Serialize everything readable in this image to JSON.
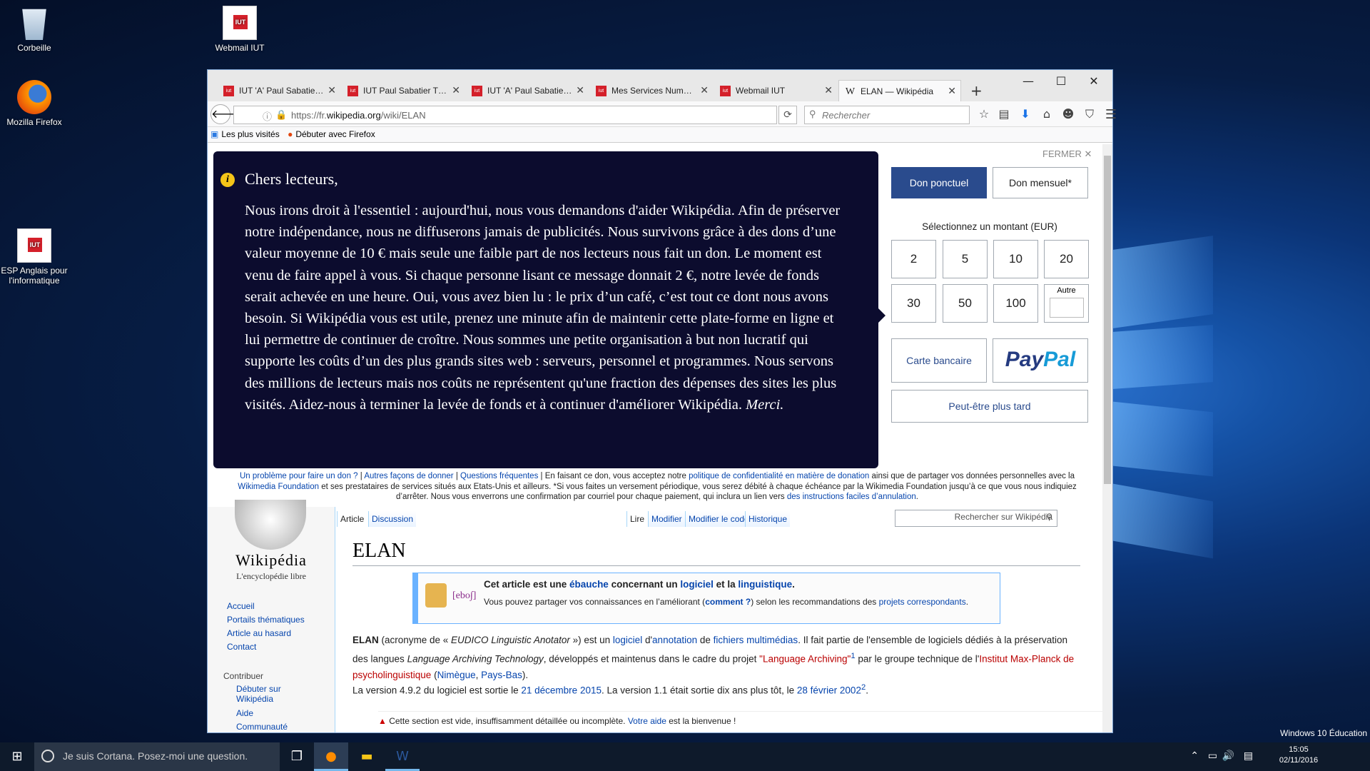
{
  "desktop": {
    "icons": [
      {
        "label": "Corbeille"
      },
      {
        "label": "Webmail IUT"
      },
      {
        "label": "Mozilla Firefox"
      },
      {
        "label": "ESP Anglais pour l'informatique"
      }
    ],
    "watermark": "Windows 10 Éducation"
  },
  "browser": {
    "tabs": [
      {
        "label": "IUT 'A' Paul Sabatie…",
        "favicon": "iut"
      },
      {
        "label": "IUT Paul Sabatier T…",
        "favicon": "iut"
      },
      {
        "label": "IUT 'A' Paul Sabatie…",
        "favicon": "iut"
      },
      {
        "label": "Mes Services Num…",
        "favicon": "iut"
      },
      {
        "label": "Webmail IUT",
        "favicon": "iut"
      },
      {
        "label": "ELAN — Wikipédia",
        "favicon": "W"
      }
    ],
    "url_prefix": "https://fr.",
    "url_domain": "wikipedia.org",
    "url_path": "/wiki/ELAN",
    "search_placeholder": "Rechercher",
    "bookmarks": [
      "Les plus visités",
      "Débuter avec Firefox"
    ]
  },
  "banner": {
    "greeting": "Chers lecteurs,",
    "body": "Nous irons droit à l'essentiel : aujourd'hui, nous vous demandons d'aider Wikipédia. Afin de préserver notre indépendance, nous ne diffuserons jamais de publicités. Nous survivons grâce à des dons d’une valeur moyenne de 10 € mais seule une faible part de nos lecteurs nous fait un don. Le moment est venu de faire appel à vous. Si chaque personne lisant ce message donnait 2 €, notre levée de fonds serait achevée en une heure. Oui, vous avez bien lu : le prix d’un café, c’est tout ce dont nous avons besoin. Si Wikipédia vous est utile, prenez une minute afin de maintenir cette plate-forme en ligne et lui permettre de continuer de croître. Nous sommes une petite organisation à but non lucratif qui supporte les coûts d’un des plus grands sites web : serveurs, personnel et programmes. Nous servons des millions de lecteurs mais nos coûts ne représentent qu'une fraction des dépenses des sites les plus visités. Aidez-nous à terminer la levée de fonds et à continuer d'améliorer Wikipédia.",
    "merci": "Merci.",
    "close": "FERMER ✕",
    "once": "Don ponctuel",
    "monthly": "Don mensuel*",
    "select_amount": "Sélectionnez un montant (EUR)",
    "amounts": [
      "2",
      "5",
      "10",
      "20",
      "30",
      "50",
      "100"
    ],
    "other": "Autre",
    "card": "Carte bancaire",
    "paypal_a": "Pay",
    "paypal_b": "Pal",
    "later": "Peut-être plus tard",
    "foot_l1": "Un problème pour faire un don ?",
    "foot_l2": "Autres façons de donner",
    "foot_l3": "Questions fréquentes",
    "foot_t1": " En faisant ce don, vous acceptez notre ",
    "foot_l4": "politique de confidentialité en matière de donation",
    "foot_t2": " ainsi que de partager vos données personnelles avec la ",
    "foot_l5": "Wikimedia Foundation",
    "foot_t3": " et ses prestataires de services situés aux Etats-Unis et ailleurs. *Si vous faites un versement périodique, vous serez débité à chaque échéance par la Wikimedia Foundation jusqu’à ce que vous nous indiquiez d’arrêter. Nous vous enverrons une confirmation par courriel pour chaque paiement, qui inclura un lien vers ",
    "foot_l6": "des instructions faciles d’annulation",
    "foot_t4": "."
  },
  "wiki": {
    "wordmark": "Wikipédia",
    "tagline": "L'encyclopédie libre",
    "nav": [
      "Accueil",
      "Portails thématiques",
      "Article au hasard",
      "Contact"
    ],
    "contrib_heading": "Contribuer",
    "contrib": [
      "Débuter sur Wikipédia",
      "Aide",
      "Communauté"
    ],
    "tabs": [
      "Article",
      "Discussion",
      "Lire",
      "Modifier",
      "Modifier le code",
      "Historique"
    ],
    "search_placeholder": "Rechercher sur Wikipédia",
    "title": "ELAN",
    "stub_label": "[ebo∫]",
    "stub_t1": "Cet article est une ",
    "stub_l1": "ébauche",
    "stub_t2": " concernant un ",
    "stub_l2": "logiciel",
    "stub_t3": " et la ",
    "stub_l3": "linguistique",
    "stub_t4": ".",
    "stub_s1": "Vous pouvez partager vos connaissances en l’améliorant (",
    "stub_sl1": "comment ?",
    "stub_s2": ") selon les recommandations des ",
    "stub_sl2": "projets correspondants",
    "stub_s3": ".",
    "p1_bold": "ELAN",
    "p1_t1": " (acronyme de « ",
    "p1_i1": "EUDICO Linguistic Anotator",
    "p1_t2": " ») est un ",
    "p1_l1": "logiciel",
    "p1_t3": " d'",
    "p1_l2": "annotation",
    "p1_t4": " de ",
    "p1_l3": "fichiers multimédias",
    "p1_t5": ". Il fait partie de l'ensemble de logiciels dédiés à la préservation des langues ",
    "p1_i2": "Language Archiving Technology",
    "p1_t6": ", développés et maintenus dans le cadre du projet ",
    "p1_r1": "\"Language Archiving\"",
    "p1_sup": "1",
    "p1_t7": " par le groupe technique de l'",
    "p1_r2": "Institut Max-Planck de psycholinguistique",
    "p1_t8": " (",
    "p1_l4": "Nimègue",
    "p1_t9": ", ",
    "p1_l5": "Pays-Bas",
    "p1_t10": ").",
    "p2_t1": "La version 4.9.2 du logiciel est sortie le ",
    "p2_l1": "21 décembre 2015",
    "p2_t2": ". La version 1.1 était sortie dix ans plus tôt, le ",
    "p2_l2": "28 février 2002",
    "p2_sup": "2",
    "p2_t3": ".",
    "notice_t1": "Cette section est vide, insuffisamment détaillée ou incomplète. ",
    "notice_l1": "Votre aide",
    "notice_t2": " est la bienvenue !"
  },
  "taskbar": {
    "cortana": "Je suis Cortana. Posez-moi une question.",
    "time": "15:05",
    "date": "02/11/2016"
  }
}
